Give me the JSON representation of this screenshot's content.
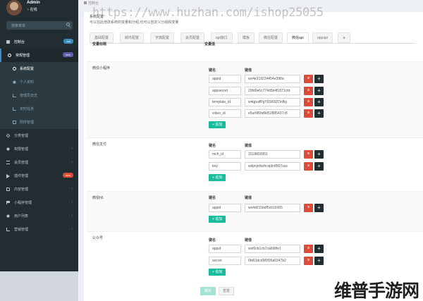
{
  "user": {
    "name": "Admin",
    "status": "在线"
  },
  "search": {
    "placeholder": "搜索菜单"
  },
  "sidebar": {
    "items": [
      {
        "label": "控制台",
        "icon": "dashboard-icon",
        "badge": "hot",
        "badge_color": "#3c8dbc"
      },
      {
        "label": "常规管理",
        "icon": "cogs-icon",
        "badge": "new",
        "badge_color": "#605ca8"
      },
      {
        "label": "系统配置",
        "icon": "circle-icon"
      },
      {
        "label": "个人资料",
        "icon": "user-icon"
      },
      {
        "label": "管理员日志",
        "icon": "bar-chart-icon"
      },
      {
        "label": "定时任务",
        "icon": "bar-chart-icon"
      },
      {
        "label": "附件管理",
        "icon": "picture-icon"
      },
      {
        "label": "分类管理",
        "icon": "cube-icon"
      },
      {
        "label": "权限管理",
        "icon": "users-icon"
      },
      {
        "label": "会员管理",
        "icon": "list-icon"
      },
      {
        "label": "插件管理",
        "icon": "rocket-icon",
        "badge": "new",
        "badge_color": "#dd4b39"
      },
      {
        "label": "内容管理",
        "icon": "file-icon"
      },
      {
        "label": "小程序管理",
        "icon": "flag-icon"
      },
      {
        "label": "用户列表",
        "icon": "user-plus-icon"
      },
      {
        "label": "营销管理",
        "icon": "bar-chart-icon"
      }
    ]
  },
  "breadcrumb": {
    "label": "控制台"
  },
  "watermark": "https://www.huzhan.com/ishop25055",
  "panel": {
    "title": "系统配置",
    "description": "可以在此增改系统的变量和分组,也可以自定义分组和变量"
  },
  "tabs": [
    "基础配置",
    "邮件配置",
    "字典配置",
    "会员配置",
    "api接口",
    "模板",
    "微信配置",
    "微信api",
    "appapi",
    "+"
  ],
  "form": {
    "col_title": "变量标题",
    "col_value": "变量值",
    "key_header": "键名",
    "value_header": "键值",
    "append_label": "+ 追加",
    "submit_label": "确定",
    "reset_label": "重置"
  },
  "groups": [
    {
      "name": "微信小程序",
      "rows": [
        {
          "key": "appid",
          "value": "wx4e319224454e398a"
        },
        {
          "key": "appsecret",
          "value": "20fd0e6c774d5b4f1871cfd"
        },
        {
          "key": "template_id",
          "value": "w4qpuifPgY9SK8ZOnBg"
        },
        {
          "key": "video_id",
          "value": "e5ur6f6bd9d52885437c8"
        }
      ]
    },
    {
      "name": "微信支付",
      "rows": [
        {
          "key": "mch_id",
          "value": "1518803951"
        },
        {
          "key": "key",
          "value": "wdjmjnhkrhcxjdn8567uxs"
        }
      ]
    },
    {
      "name": "微信h5",
      "rows": [
        {
          "key": "appid",
          "value": "wx4d015bdf5cb19365"
        }
      ]
    },
    {
      "name": "公众号",
      "rows": [
        {
          "key": "appid",
          "value": "wxf0cb1cb7ca668fe1"
        },
        {
          "key": "secret",
          "value": "6fd61dcd9f0f36a5347b2"
        }
      ]
    }
  ],
  "corner_logo": "维普手游网"
}
